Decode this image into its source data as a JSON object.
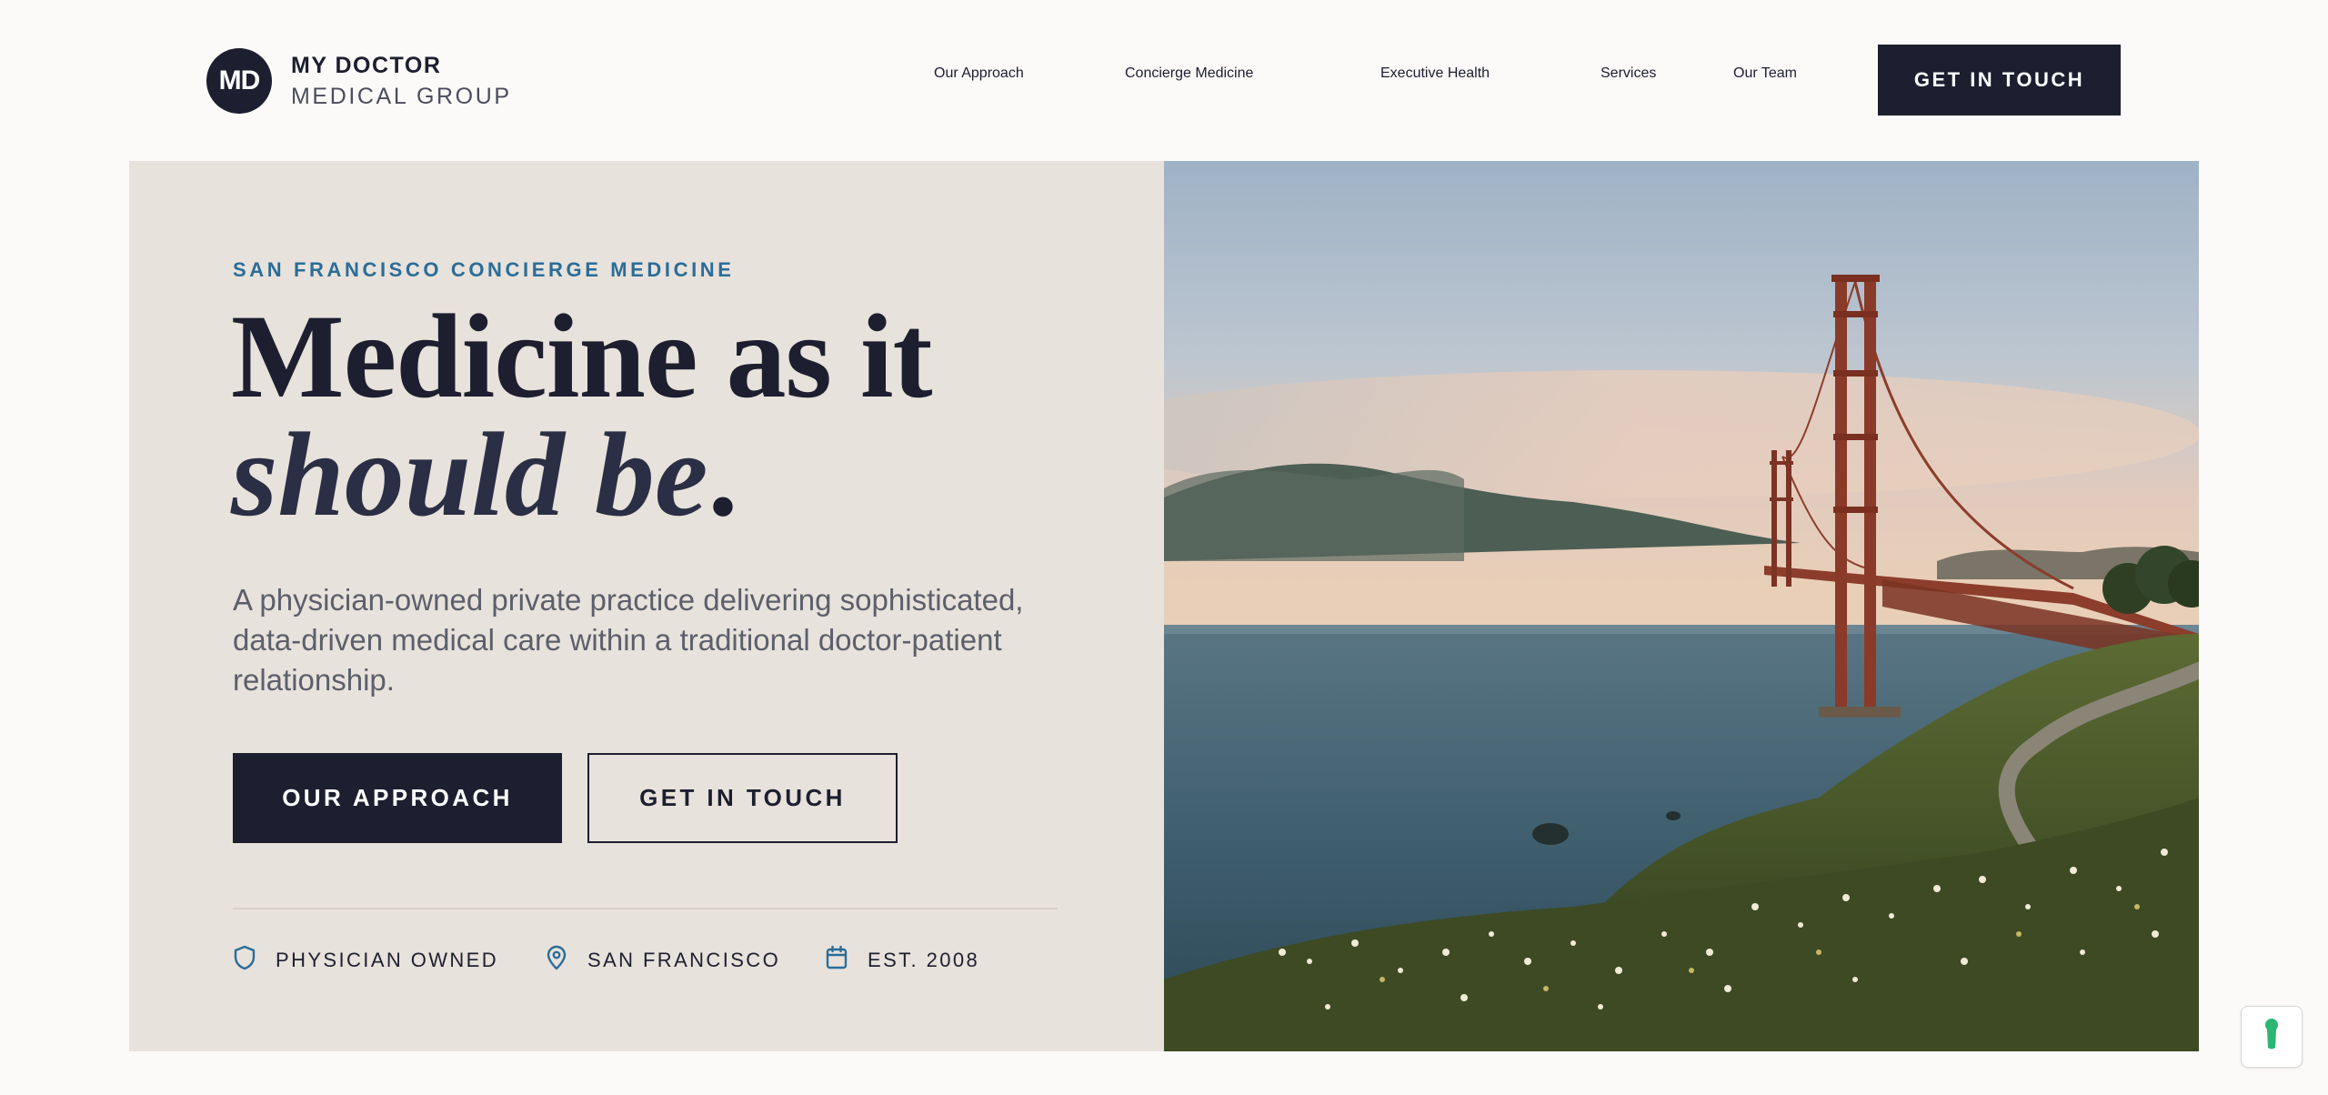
{
  "brand": {
    "mark": "MD",
    "line1": "MY DOCTOR",
    "line2": "MEDICAL GROUP"
  },
  "nav": {
    "items": [
      "Our Approach",
      "Concierge Medicine",
      "Executive Health",
      "Services",
      "Our Team"
    ],
    "cta": "GET IN TOUCH"
  },
  "hero": {
    "eyebrow": "SAN FRANCISCO CONCIERGE MEDICINE",
    "headline_line1": "Medicine as it",
    "headline_line2": "should be",
    "headline_punct": ".",
    "subtext": "A physician-owned private practice delivering sophisticated, data-driven medical care within a traditional doctor-patient relationship.",
    "primary_button": "OUR APPROACH",
    "secondary_button": "GET IN TOUCH",
    "features": [
      {
        "icon": "shield-icon",
        "label": "PHYSICIAN OWNED"
      },
      {
        "icon": "location-pin-icon",
        "label": "SAN FRANCISCO"
      },
      {
        "icon": "calendar-icon",
        "label": "EST. 2008"
      }
    ],
    "image_subject": "golden-gate-bridge-photo"
  },
  "colors": {
    "navy": "#1d1f30",
    "accent_blue": "#2a6d98",
    "hero_beige": "#e8e2dc",
    "page_bg": "#fcfaf8",
    "widget_green": "#2bb673"
  }
}
